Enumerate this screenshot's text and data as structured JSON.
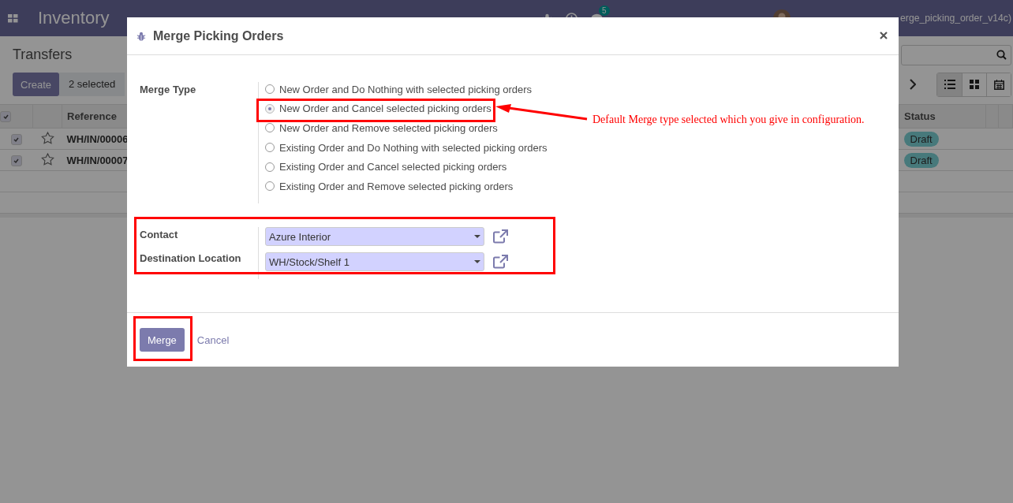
{
  "navbar": {
    "app_name": "Inventory",
    "chat_count": "5",
    "user": "erge_picking_order_v14c)"
  },
  "control_panel": {
    "title": "Transfers",
    "create_button": "Create",
    "selection_count": "2 selected"
  },
  "table": {
    "all_checked": true,
    "columns": [
      "Reference",
      "Status"
    ],
    "rows": [
      {
        "checked": true,
        "reference": "WH/IN/00006",
        "status": "Draft"
      },
      {
        "checked": true,
        "reference": "WH/IN/00007",
        "status": "Draft"
      }
    ]
  },
  "dialog": {
    "title": "Merge Picking Orders",
    "merge_type_label": "Merge Type",
    "merge_types": [
      {
        "label": "New Order and Do Nothing with selected picking orders",
        "selected": false
      },
      {
        "label": "New Order and Cancel selected picking orders",
        "selected": true
      },
      {
        "label": "New Order and Remove selected picking orders",
        "selected": false
      },
      {
        "label": "Existing Order and Do Nothing with selected picking orders",
        "selected": false
      },
      {
        "label": "Existing Order and Cancel selected picking orders",
        "selected": false
      },
      {
        "label": "Existing Order and Remove selected picking orders",
        "selected": false
      }
    ],
    "fields": [
      {
        "label": "Contact",
        "value": "Azure Interior"
      },
      {
        "label": "Destination Location",
        "value": "WH/Stock/Shelf 1"
      }
    ],
    "buttons": {
      "primary": "Merge",
      "secondary": "Cancel"
    }
  },
  "annotation": {
    "text": "Default Merge type selected which you give in configuration."
  }
}
